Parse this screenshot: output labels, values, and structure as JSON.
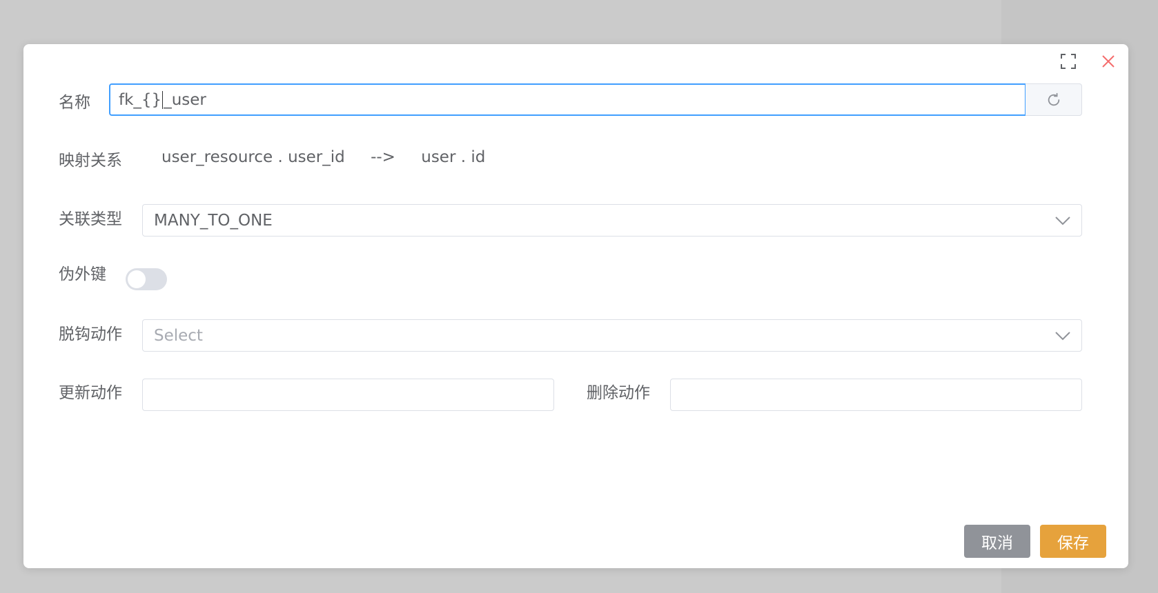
{
  "form": {
    "name": {
      "label": "名称",
      "value_before_caret": "fk_{}",
      "value_after_caret": "_user",
      "refresh_icon": "refresh-icon"
    },
    "mapping": {
      "label": "映射关系",
      "source": "user_resource . user_id",
      "arrow": "-->",
      "target": "user . id"
    },
    "relation_type": {
      "label": "关联类型",
      "value": "MANY_TO_ONE"
    },
    "pseudo_fk": {
      "label": "伪外键",
      "enabled": false
    },
    "unhook_action": {
      "label": "脱钩动作",
      "placeholder": "Select"
    },
    "update_action": {
      "label": "更新动作",
      "value": ""
    },
    "delete_action": {
      "label": "删除动作",
      "value": ""
    }
  },
  "footer": {
    "cancel_label": "取消",
    "save_label": "保存"
  },
  "colors": {
    "accent": "#409eff",
    "save": "#e6a23c",
    "cancel": "#909399",
    "close": "#f56c6c"
  }
}
